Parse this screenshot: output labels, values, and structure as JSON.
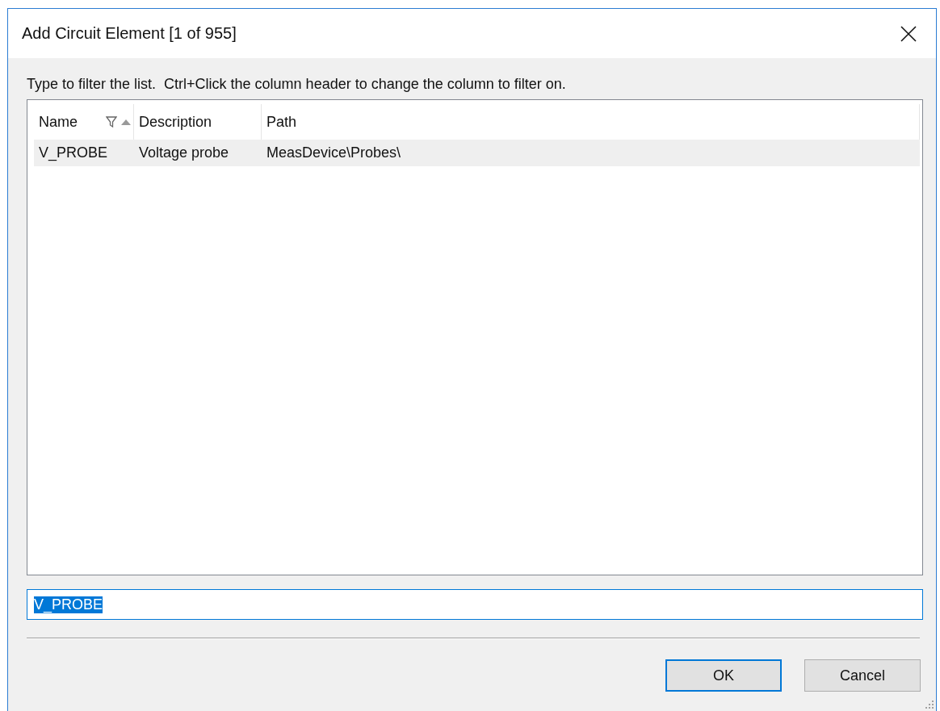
{
  "window": {
    "title": "Add Circuit Element [1 of 955]"
  },
  "instruction": "Type to filter the list.  Ctrl+Click the column header to change the column to filter on.",
  "table": {
    "columns": [
      {
        "label": "Name",
        "filtered": true,
        "sorted_ascending": true
      },
      {
        "label": "Description",
        "filtered": false,
        "sorted_ascending": false
      },
      {
        "label": "Path",
        "filtered": false,
        "sorted_ascending": false
      }
    ],
    "rows": [
      {
        "cells": [
          "V_PROBE",
          "Voltage probe",
          "MeasDevice\\Probes\\"
        ],
        "selected": true
      }
    ]
  },
  "filter_field": {
    "value": "V_PROBE",
    "text_selected": true,
    "focused": true
  },
  "buttons": [
    {
      "label": "OK",
      "default": true
    },
    {
      "label": "Cancel",
      "default": false
    }
  ]
}
